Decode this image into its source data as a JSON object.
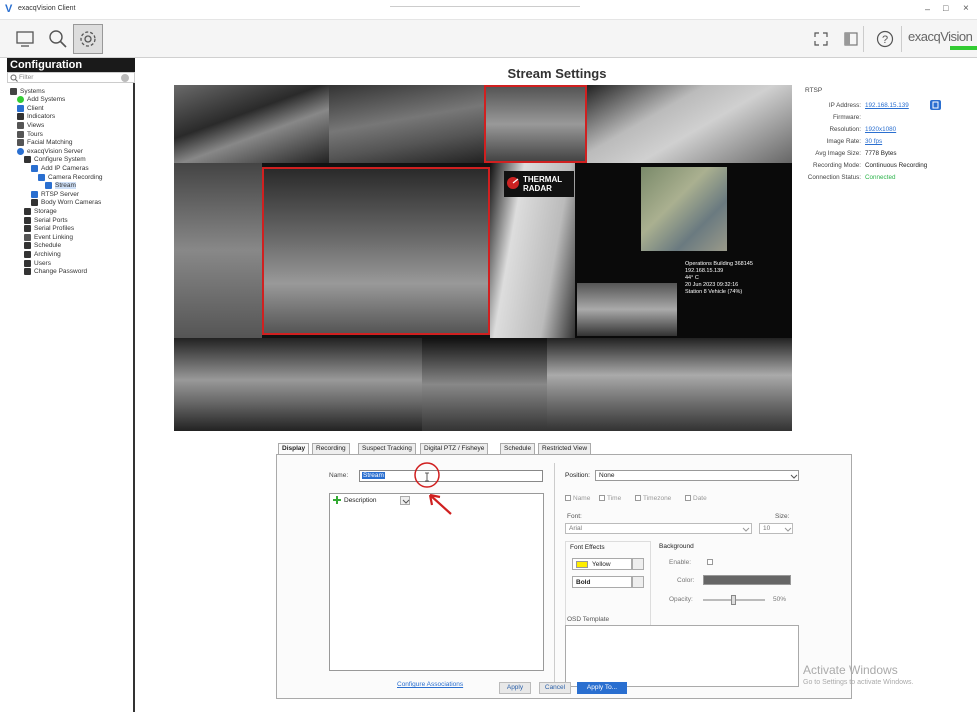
{
  "window": {
    "title": "exacqVision Client",
    "min": "–",
    "max": "□",
    "close": "×"
  },
  "toolbar": {
    "logo": "exacqVision"
  },
  "sidebar": {
    "header": "Configuration",
    "filter_placeholder": "Filter",
    "items": [
      {
        "label": "Systems",
        "depth": 0,
        "icon": "systems-icon",
        "color": "#444"
      },
      {
        "label": "Add Systems",
        "depth": 1,
        "icon": "add-icon",
        "color": "#3c3"
      },
      {
        "label": "Client",
        "depth": 1,
        "icon": "client-icon",
        "color": "#2a6fd0"
      },
      {
        "label": "Indicators",
        "depth": 1,
        "icon": "indicators-icon",
        "color": "#333"
      },
      {
        "label": "Views",
        "depth": 1,
        "icon": "views-icon",
        "color": "#555"
      },
      {
        "label": "Tours",
        "depth": 1,
        "icon": "tours-icon",
        "color": "#555"
      },
      {
        "label": "Facial Matching",
        "depth": 1,
        "icon": "face-icon",
        "color": "#555"
      },
      {
        "label": "exacqVision Server",
        "depth": 1,
        "icon": "server-icon",
        "color": "#2a6fd0"
      },
      {
        "label": "Configure System",
        "depth": 2,
        "icon": "config-icon",
        "color": "#333"
      },
      {
        "label": "Add IP Cameras",
        "depth": 3,
        "icon": "camera-icon",
        "color": "#2a6fd0"
      },
      {
        "label": "Camera Recording",
        "depth": 4,
        "icon": "camera-icon",
        "color": "#2a6fd0"
      },
      {
        "label": "Stream",
        "depth": 5,
        "icon": "camera-icon",
        "color": "#2a6fd0"
      },
      {
        "label": "RTSP Server",
        "depth": 3,
        "icon": "rtsp-icon",
        "color": "#2a6fd0"
      },
      {
        "label": "Body Worn Cameras",
        "depth": 3,
        "icon": "person-icon",
        "color": "#333"
      },
      {
        "label": "Storage",
        "depth": 2,
        "icon": "storage-icon",
        "color": "#333"
      },
      {
        "label": "Serial Ports",
        "depth": 2,
        "icon": "serial-icon",
        "color": "#333"
      },
      {
        "label": "Serial Profiles",
        "depth": 2,
        "icon": "serial-profile-icon",
        "color": "#333"
      },
      {
        "label": "Event Linking",
        "depth": 2,
        "icon": "link-icon",
        "color": "#555"
      },
      {
        "label": "Schedule",
        "depth": 2,
        "icon": "schedule-icon",
        "color": "#333"
      },
      {
        "label": "Archiving",
        "depth": 2,
        "icon": "archive-icon",
        "color": "#333"
      },
      {
        "label": "Users",
        "depth": 2,
        "icon": "users-icon",
        "color": "#333"
      },
      {
        "label": "Change Password",
        "depth": 2,
        "icon": "password-icon",
        "color": "#333"
      }
    ]
  },
  "main": {
    "title": "Stream Settings"
  },
  "video": {
    "brand_line1": "THERMAL",
    "brand_line2": "RADAR",
    "overlay": [
      "Operations Building 368145",
      "192.168.15.139",
      "44° C",
      "20 Jun 2023 09:32:16",
      "Station 8 Vehicle (74%)"
    ]
  },
  "rtsp": {
    "header": "RTSP",
    "rows": [
      {
        "label": "IP Address:",
        "value": "192.168.15.139",
        "link": true
      },
      {
        "label": "Firmware:",
        "value": "",
        "link": false
      },
      {
        "label": "Resolution:",
        "value": "1920x1080",
        "link": true
      },
      {
        "label": "Image Rate:",
        "value": "30 fps",
        "link": true
      },
      {
        "label": "Avg Image Size:",
        "value": "7778 Bytes",
        "link": false
      },
      {
        "label": "Recording Mode:",
        "value": "Continuous Recording",
        "link": false
      },
      {
        "label": "Connection Status:",
        "value": "Connected",
        "link": false,
        "color": "#2bb34a"
      }
    ]
  },
  "tabs": [
    "Display",
    "Recording",
    "Suspect Tracking",
    "Digital PTZ / Fisheye",
    "Schedule",
    "Restricted View"
  ],
  "form": {
    "name_label": "Name:",
    "name_value": "Stream",
    "description_label": "Description",
    "configure_link": "Configure Associations",
    "position_label": "Position:",
    "position_value": "None",
    "checks": [
      "Name",
      "Time",
      "Timezone",
      "Date"
    ],
    "font_label": "Font:",
    "font_value": "Arial",
    "size_label": "Size:",
    "size_value": "10",
    "font_effects_label": "Font Effects",
    "color_value": "Yellow",
    "style_value": "Bold",
    "background_label": "Background",
    "enable_label": "Enable:",
    "color_label": "Color:",
    "opacity_label": "Opacity:",
    "opacity_value": "50%",
    "osd_label": "OSD Template"
  },
  "buttons": {
    "apply": "Apply",
    "cancel": "Cancel",
    "apply_to": "Apply To..."
  },
  "watermark": {
    "line1": "Activate Windows",
    "line2": "Go to Settings to activate Windows."
  }
}
